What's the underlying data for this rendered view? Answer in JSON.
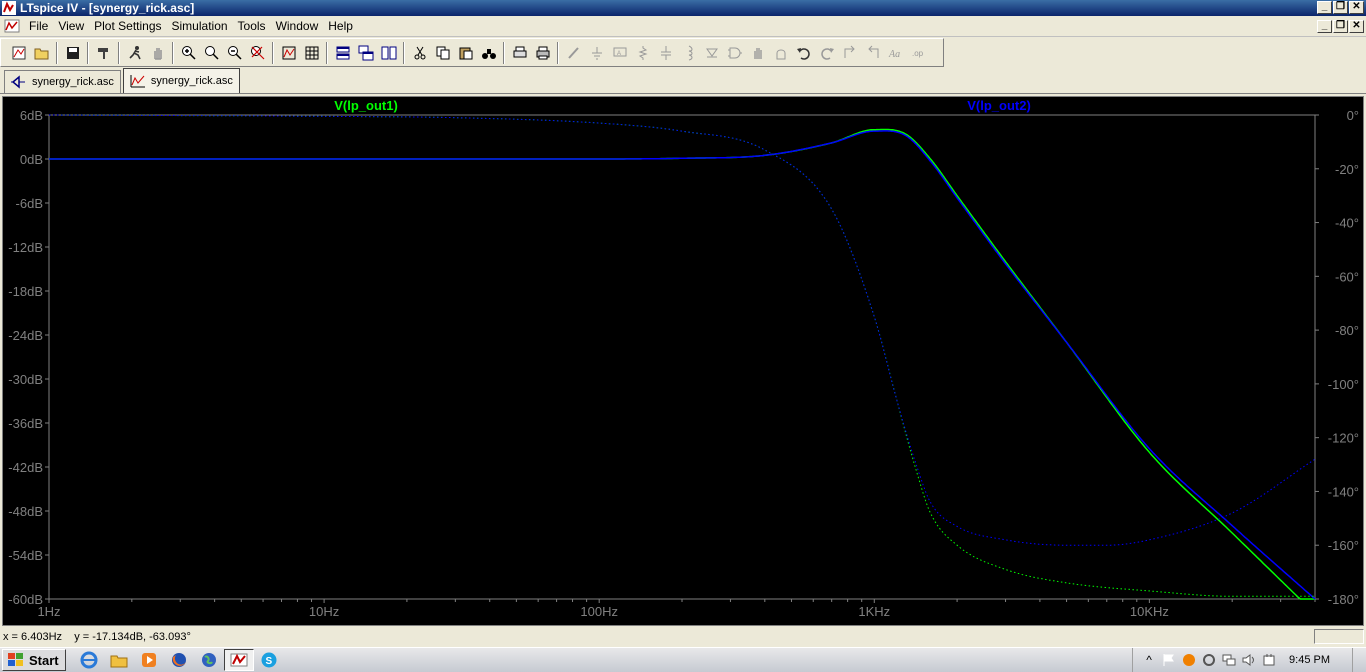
{
  "window": {
    "title": "LTspice IV - [synergy_rick.asc]",
    "controls": [
      "_",
      "❐",
      "✕"
    ]
  },
  "menu": [
    {
      "label": "File",
      "name": "menu-file"
    },
    {
      "label": "View",
      "name": "menu-view"
    },
    {
      "label": "Plot Settings",
      "name": "menu-plot-settings"
    },
    {
      "label": "Simulation",
      "name": "menu-simulation"
    },
    {
      "label": "Tools",
      "name": "menu-tools"
    },
    {
      "label": "Window",
      "name": "menu-window"
    },
    {
      "label": "Help",
      "name": "menu-help"
    }
  ],
  "tabs": [
    {
      "label": "synergy_rick.asc",
      "kind": "schematic",
      "active": false
    },
    {
      "label": "synergy_rick.asc",
      "kind": "waveform",
      "active": true
    }
  ],
  "plot": {
    "background": "#000000",
    "traces": [
      {
        "label": "V(lp_out1)",
        "color": "#00ff00"
      },
      {
        "label": "V(lp_out2)",
        "color": "#0000ff"
      }
    ],
    "x_axis": {
      "scale": "log",
      "range_hz": [
        1,
        40000
      ],
      "ticks": [
        {
          "value": 1,
          "label": "1Hz"
        },
        {
          "value": 10,
          "label": "10Hz"
        },
        {
          "value": 100,
          "label": "100Hz"
        },
        {
          "value": 1000,
          "label": "1KHz"
        },
        {
          "value": 10000,
          "label": "10KHz"
        }
      ]
    },
    "y_left": {
      "range_db": [
        -60,
        6
      ],
      "ticks": [
        "6dB",
        "0dB",
        "-6dB",
        "-12dB",
        "-18dB",
        "-24dB",
        "-30dB",
        "-36dB",
        "-42dB",
        "-48dB",
        "-54dB",
        "-60dB"
      ]
    },
    "y_right": {
      "range_deg": [
        -180,
        0
      ],
      "ticks": [
        "0°",
        "-20°",
        "-40°",
        "-60°",
        "-80°",
        "-100°",
        "-120°",
        "-140°",
        "-160°",
        "-180°"
      ]
    }
  },
  "chart_data": {
    "type": "line",
    "title": "",
    "xlabel": "",
    "ylabel": "",
    "x_scale": "log",
    "xlim": [
      1,
      40000
    ],
    "ylim": [
      -60,
      6
    ],
    "y2lim": [
      -180,
      0
    ],
    "grid": false,
    "series": [
      {
        "name": "V(lp_out1)",
        "quantity": "magnitude_db",
        "color": "#00ff00",
        "style": "solid",
        "x": [
          1,
          10,
          100,
          200,
          400,
          700,
          1000,
          1300,
          1600,
          2000,
          3000,
          5000,
          10000,
          20000,
          40000
        ],
        "y": [
          0,
          0,
          0,
          0.1,
          0.5,
          2.2,
          4.0,
          3.4,
          0,
          -5,
          -14,
          -25,
          -40,
          -51,
          -62
        ]
      },
      {
        "name": "V(lp_out2)",
        "quantity": "magnitude_db",
        "color": "#0000ff",
        "style": "solid",
        "x": [
          1,
          10,
          100,
          200,
          400,
          700,
          1000,
          1300,
          1600,
          2000,
          3000,
          5000,
          10000,
          20000,
          40000
        ],
        "y": [
          0,
          0,
          0,
          0.1,
          0.5,
          2.2,
          3.8,
          3.2,
          -0.3,
          -5.3,
          -14.3,
          -25,
          -39.5,
          -50,
          -60
        ]
      },
      {
        "name": "V(lp_out1)",
        "quantity": "phase_deg",
        "color": "#00ff00",
        "style": "dotted",
        "x": [
          1,
          10,
          30,
          100,
          200,
          400,
          700,
          1000,
          1200,
          1400,
          1600,
          2000,
          3000,
          5000,
          10000,
          20000,
          40000
        ],
        "y": [
          0,
          -0.5,
          -1,
          -3,
          -6,
          -13,
          -35,
          -75,
          -105,
          -130,
          -148,
          -160,
          -169,
          -174,
          -177,
          -179,
          -179
        ]
      },
      {
        "name": "V(lp_out2)",
        "quantity": "phase_deg",
        "color": "#0000ff",
        "style": "dotted",
        "x": [
          1,
          10,
          30,
          100,
          200,
          400,
          700,
          1000,
          1200,
          1400,
          1600,
          2000,
          3000,
          5000,
          7000,
          10000,
          20000,
          40000
        ],
        "y": [
          0,
          -0.5,
          -1,
          -3,
          -6,
          -13,
          -35,
          -75,
          -105,
          -128,
          -144,
          -153,
          -158,
          -160,
          -160,
          -158,
          -148,
          -128
        ]
      }
    ]
  },
  "status": {
    "readout": "x = 6.403Hz    y = -17.134dB, -63.093°"
  },
  "taskbar": {
    "start_label": "Start",
    "clock": "9:45 PM"
  }
}
